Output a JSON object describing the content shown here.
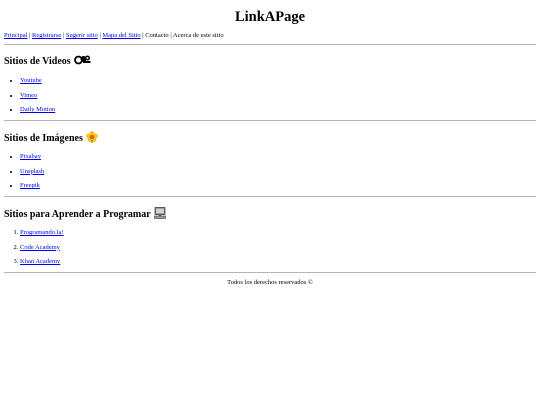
{
  "header": {
    "title": "LinkAPage"
  },
  "nav": {
    "items": [
      {
        "label": "Principal",
        "link": true
      },
      {
        "label": "Registrarse",
        "link": true
      },
      {
        "label": "Sugerir sitio",
        "link": true
      },
      {
        "label": "Mapa del Sitio",
        "link": true
      },
      {
        "label": "Contacto",
        "link": false
      },
      {
        "label": "Acerca de este sitio",
        "link": false
      }
    ]
  },
  "sections": [
    {
      "title": "Sitios de Videos",
      "icon": "video-camera-icon",
      "list_type": "unordered",
      "links": [
        "Youtube",
        "Vimeo",
        "Daily Motion"
      ]
    },
    {
      "title": "Sitios de Imágenes",
      "icon": "flower-icon",
      "list_type": "unordered",
      "links": [
        "Pixabay",
        "Unsplash",
        "Freepik"
      ]
    },
    {
      "title": "Sitios para Aprender a Programar",
      "icon": "computer-icon",
      "list_type": "ordered",
      "links": [
        "Programando.la!",
        "Code Academy",
        "Khan Academy"
      ]
    }
  ],
  "footer": {
    "text": "Todos los derechos reservados ©"
  },
  "colors": {
    "link": "#0000ee",
    "divider": "#b5b5b5"
  }
}
